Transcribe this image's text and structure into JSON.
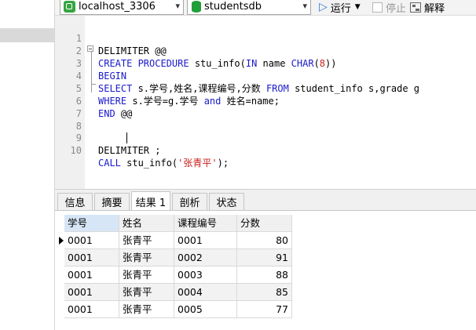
{
  "toolbar": {
    "connection": "localhost_3306",
    "database": "studentsdb",
    "run_label": "运行",
    "stop_label": "停止",
    "explain_label": "解释"
  },
  "editor": {
    "lines": [
      {
        "n": "1",
        "text": "DELIMITER @@"
      },
      {
        "n": "2",
        "text": "CREATE PROCEDURE stu_info(IN name CHAR(8))"
      },
      {
        "n": "3",
        "text": "BEGIN"
      },
      {
        "n": "4",
        "text": "SELECT s.学号,姓名,课程编号,分数 FROM student_info s,grade g"
      },
      {
        "n": "5",
        "text": "WHERE s.学号=g.学号 and 姓名=name;"
      },
      {
        "n": "6",
        "text": "END @@"
      },
      {
        "n": "7",
        "text": ""
      },
      {
        "n": "8",
        "text": ""
      },
      {
        "n": "9",
        "text": "DELIMITER ;"
      },
      {
        "n": "10",
        "text": "CALL stu_info('张青平');"
      }
    ]
  },
  "result_tabs": [
    "信息",
    "摘要",
    "结果 1",
    "剖析",
    "状态"
  ],
  "grid": {
    "columns": [
      "学号",
      "姓名",
      "课程编号",
      "分数"
    ],
    "rows": [
      [
        "0001",
        "张青平",
        "0001",
        "80"
      ],
      [
        "0001",
        "张青平",
        "0002",
        "91"
      ],
      [
        "0001",
        "张青平",
        "0003",
        "88"
      ],
      [
        "0001",
        "张青平",
        "0004",
        "85"
      ],
      [
        "0001",
        "张青平",
        "0005",
        "77"
      ]
    ]
  },
  "colors": {
    "keyword": "#1a1acb",
    "string": "#c8201c",
    "connection_icon": "#37a542",
    "run_icon": "#2d78d6"
  },
  "icons": {
    "connection": "connection-icon",
    "database": "database-icon",
    "run": "play-triangle-icon",
    "explain": "explain-icon",
    "row_pointer": "row-pointer-icon"
  }
}
